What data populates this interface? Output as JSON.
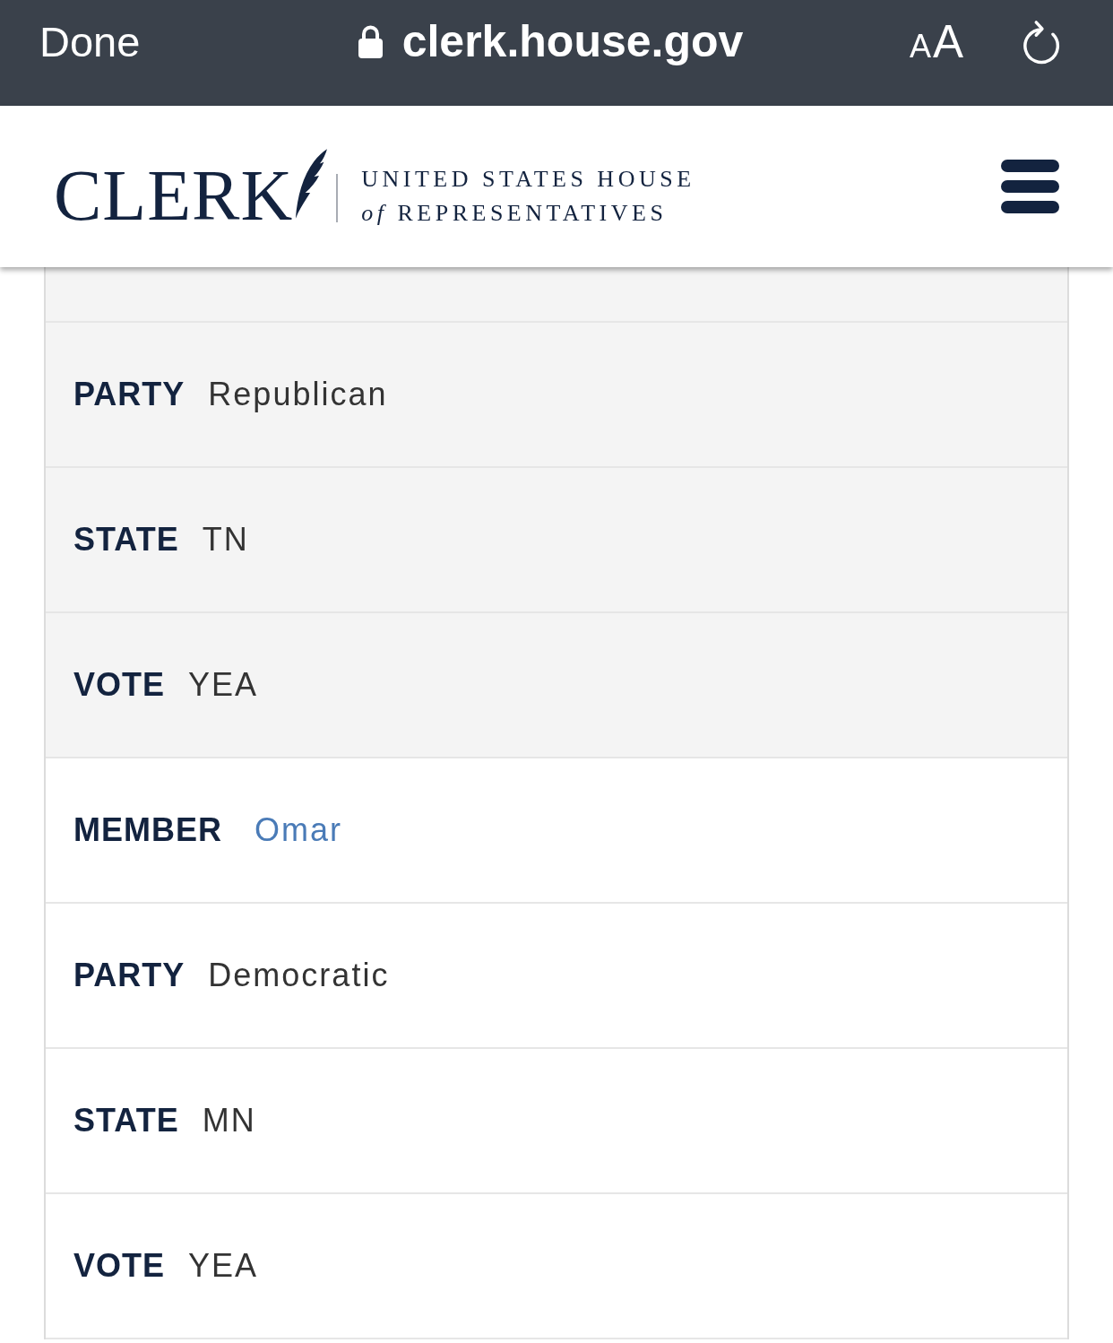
{
  "browser_bar": {
    "done_label": "Done",
    "address": "clerk.house.gov",
    "text_size": {
      "small": "A",
      "large": "A"
    }
  },
  "site_header": {
    "wordmark": "CLERK",
    "subtitle_lines": [
      "UNITED STATES HOUSE",
      "*of* REPRESENTATIVES"
    ]
  },
  "records": [
    {
      "fields": [
        {
          "kind": "text",
          "label": "PARTY",
          "value": "Republican"
        },
        {
          "kind": "text",
          "label": "STATE",
          "value": "TN"
        },
        {
          "kind": "text",
          "label": "VOTE",
          "value": "YEA"
        }
      ]
    },
    {
      "fields": [
        {
          "kind": "link",
          "label": "MEMBER",
          "value": "Omar"
        },
        {
          "kind": "text",
          "label": "PARTY",
          "value": "Democratic"
        },
        {
          "kind": "text",
          "label": "STATE",
          "value": "MN"
        },
        {
          "kind": "text",
          "label": "VOTE",
          "value": "YEA"
        }
      ]
    }
  ]
}
